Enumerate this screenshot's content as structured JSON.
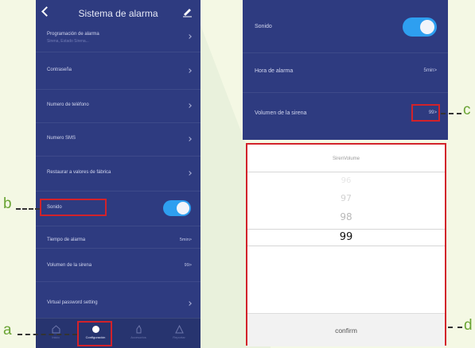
{
  "left_screen": {
    "title": "Sistema de alarma",
    "rows": [
      {
        "label": "Programación de alarma",
        "sub": "Sirena, Estado Sirena..."
      },
      {
        "label": "Contraseña"
      },
      {
        "label": "Numero de teléfono"
      },
      {
        "label": "Numero SMS"
      },
      {
        "label": "Restaurar a valores de fábrica"
      },
      {
        "label": "Sonido"
      },
      {
        "label": "Tiempo de alarma",
        "value": "5min>"
      },
      {
        "label": "Volumen de la sirena",
        "value": "99>"
      },
      {
        "label": "Virtual password setting"
      }
    ],
    "sound_toggle_on": true,
    "bottom_nav": [
      {
        "label": "Inicio",
        "icon": "home-icon"
      },
      {
        "label": "Configuración",
        "icon": "settings-icon"
      },
      {
        "label": "Accesorios",
        "icon": "accessory-icon"
      },
      {
        "label": "Reportar",
        "icon": "warning-icon"
      }
    ]
  },
  "right_top_screen": {
    "rows": [
      {
        "label": "Sonido"
      },
      {
        "label": "Hora de alarma",
        "value": "5min>"
      },
      {
        "label": "Volumen de la sirena",
        "value": "99>"
      }
    ],
    "sound_toggle_on": true
  },
  "picker": {
    "title": "SirenVolume",
    "options": [
      "96",
      "97",
      "98",
      "99"
    ],
    "selected": "99",
    "confirm_label": "confirm"
  },
  "callouts": {
    "a": "a",
    "b": "b",
    "c": "c",
    "d": "d"
  },
  "colors": {
    "panel_bg": "#2e3b80",
    "toggle_on": "#2e9ff0",
    "highlight": "#d2222a",
    "callout": "#6aa434"
  }
}
